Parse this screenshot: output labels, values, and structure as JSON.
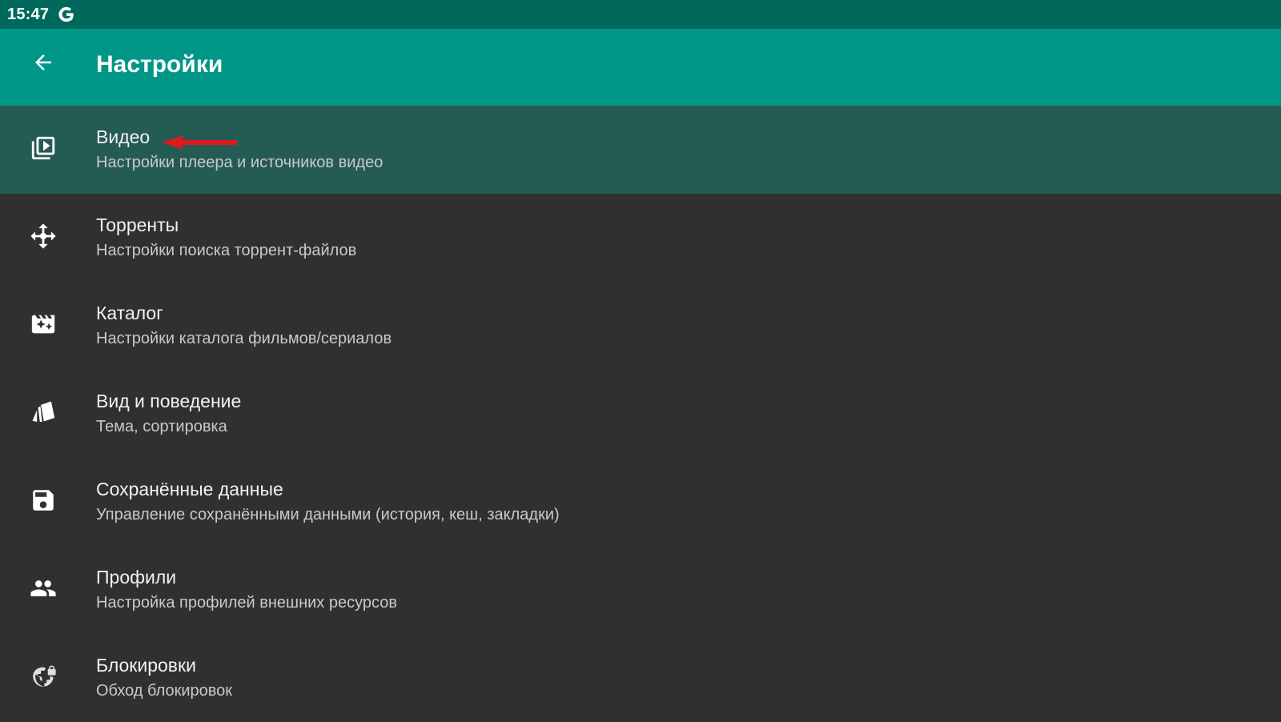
{
  "status_bar": {
    "time": "15:47",
    "google_icon": "google-g-icon"
  },
  "app_bar": {
    "title": "Настройки",
    "back_icon": "arrow-back-icon",
    "color": "#009688"
  },
  "settings": [
    {
      "id": "video",
      "title": "Видео",
      "subtitle": "Настройки плеера и источников видео",
      "icon": "video-library-icon",
      "selected": true
    },
    {
      "id": "torrents",
      "title": "Торренты",
      "subtitle": "Настройки поиска торрент-файлов",
      "icon": "torrent-icon",
      "selected": false
    },
    {
      "id": "catalog",
      "title": "Каталог",
      "subtitle": "Настройки каталога фильмов/сериалов",
      "icon": "movie-filter-icon",
      "selected": false
    },
    {
      "id": "appearance",
      "title": "Вид и поведение",
      "subtitle": "Тема, сортировка",
      "icon": "swatch-icon",
      "selected": false
    },
    {
      "id": "saved-data",
      "title": "Сохранённые данные",
      "subtitle": "Управление сохранёнными данными (история, кеш, закладки)",
      "icon": "save-icon",
      "selected": false
    },
    {
      "id": "profiles",
      "title": "Профили",
      "subtitle": "Настройка профилей внешних ресурсов",
      "icon": "people-icon",
      "selected": false
    },
    {
      "id": "blocks",
      "title": "Блокировки",
      "subtitle": "Обход блокировок",
      "icon": "globe-lock-icon",
      "selected": false
    }
  ],
  "annotation": {
    "icon": "red-arrow-icon",
    "color": "#e0191e"
  }
}
